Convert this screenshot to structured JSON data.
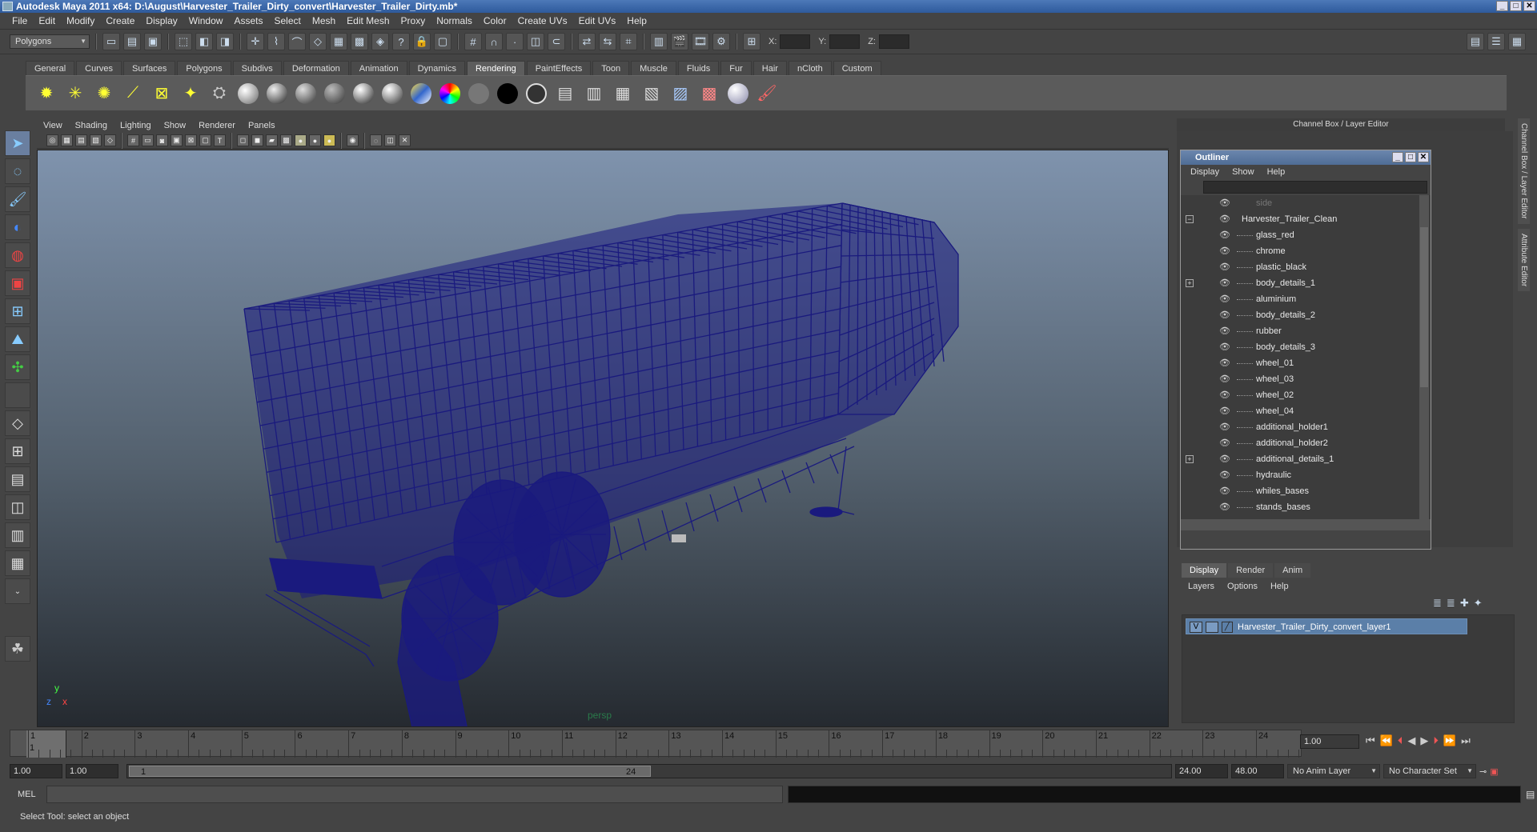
{
  "window": {
    "title": "Autodesk Maya 2011 x64: D:\\August\\Harvester_Trailer_Dirty_convert\\Harvester_Trailer_Dirty.mb*"
  },
  "menubar": [
    "File",
    "Edit",
    "Modify",
    "Create",
    "Display",
    "Window",
    "Assets",
    "Select",
    "Mesh",
    "Edit Mesh",
    "Proxy",
    "Normals",
    "Color",
    "Create UVs",
    "Edit UVs",
    "Help"
  ],
  "statusline": {
    "mode": "Polygons",
    "x_label": "X:",
    "y_label": "Y:",
    "z_label": "Z:"
  },
  "shelf_tabs": [
    "General",
    "Curves",
    "Surfaces",
    "Polygons",
    "Subdivs",
    "Deformation",
    "Animation",
    "Dynamics",
    "Rendering",
    "PaintEffects",
    "Toon",
    "Muscle",
    "Fluids",
    "Fur",
    "Hair",
    "nCloth",
    "Custom"
  ],
  "shelf_active": "Rendering",
  "viewport": {
    "menu": [
      "View",
      "Shading",
      "Lighting",
      "Show",
      "Renderer",
      "Panels"
    ],
    "camera": "persp",
    "axis": {
      "x": "x",
      "y": "y",
      "z": "z"
    },
    "wire_color": "#1a1a7e"
  },
  "channel_box": {
    "title": "Channel Box / Layer Editor"
  },
  "side_tabs": [
    "Channel Box / Layer Editor",
    "Attribute Editor"
  ],
  "outliner": {
    "title": "Outliner",
    "menu": [
      "Display",
      "Show",
      "Help"
    ],
    "items": [
      {
        "label": "side",
        "dim": true
      },
      {
        "label": "Harvester_Trailer_Clean",
        "expand": "−"
      },
      {
        "label": "glass_red"
      },
      {
        "label": "chrome"
      },
      {
        "label": "plastic_black"
      },
      {
        "label": "body_details_1",
        "expand": "+"
      },
      {
        "label": "aluminium"
      },
      {
        "label": "body_details_2"
      },
      {
        "label": "rubber"
      },
      {
        "label": "body_details_3"
      },
      {
        "label": "wheel_01"
      },
      {
        "label": "wheel_03"
      },
      {
        "label": "wheel_02"
      },
      {
        "label": "wheel_04"
      },
      {
        "label": "additional_holder1"
      },
      {
        "label": "additional_holder2"
      },
      {
        "label": "additional_details_1",
        "expand": "+"
      },
      {
        "label": "hydraulic"
      },
      {
        "label": "whiles_bases"
      },
      {
        "label": "stands_bases"
      }
    ]
  },
  "layer_editor": {
    "tabs": [
      "Display",
      "Render",
      "Anim"
    ],
    "active_tab": "Display",
    "menu": [
      "Layers",
      "Options",
      "Help"
    ],
    "layer": {
      "visible": "V",
      "name": "Harvester_Trailer_Dirty_convert_layer1"
    }
  },
  "timeline": {
    "ticks": [
      "1",
      "2",
      "3",
      "4",
      "5",
      "6",
      "7",
      "8",
      "9",
      "10",
      "11",
      "12",
      "13",
      "14",
      "15",
      "16",
      "17",
      "18",
      "19",
      "20",
      "21",
      "22",
      "23",
      "24"
    ],
    "current_time": "1.00",
    "current_marker": "1",
    "range_start": "1.00",
    "playback_start": "1.00",
    "slider_start": "1",
    "slider_end": "24",
    "playback_end": "24.00",
    "range_end": "48.00",
    "anim_layer": "No Anim Layer",
    "character_set": "No Character Set"
  },
  "command_line": {
    "label": "MEL"
  },
  "help_line": "Select Tool: select an object"
}
